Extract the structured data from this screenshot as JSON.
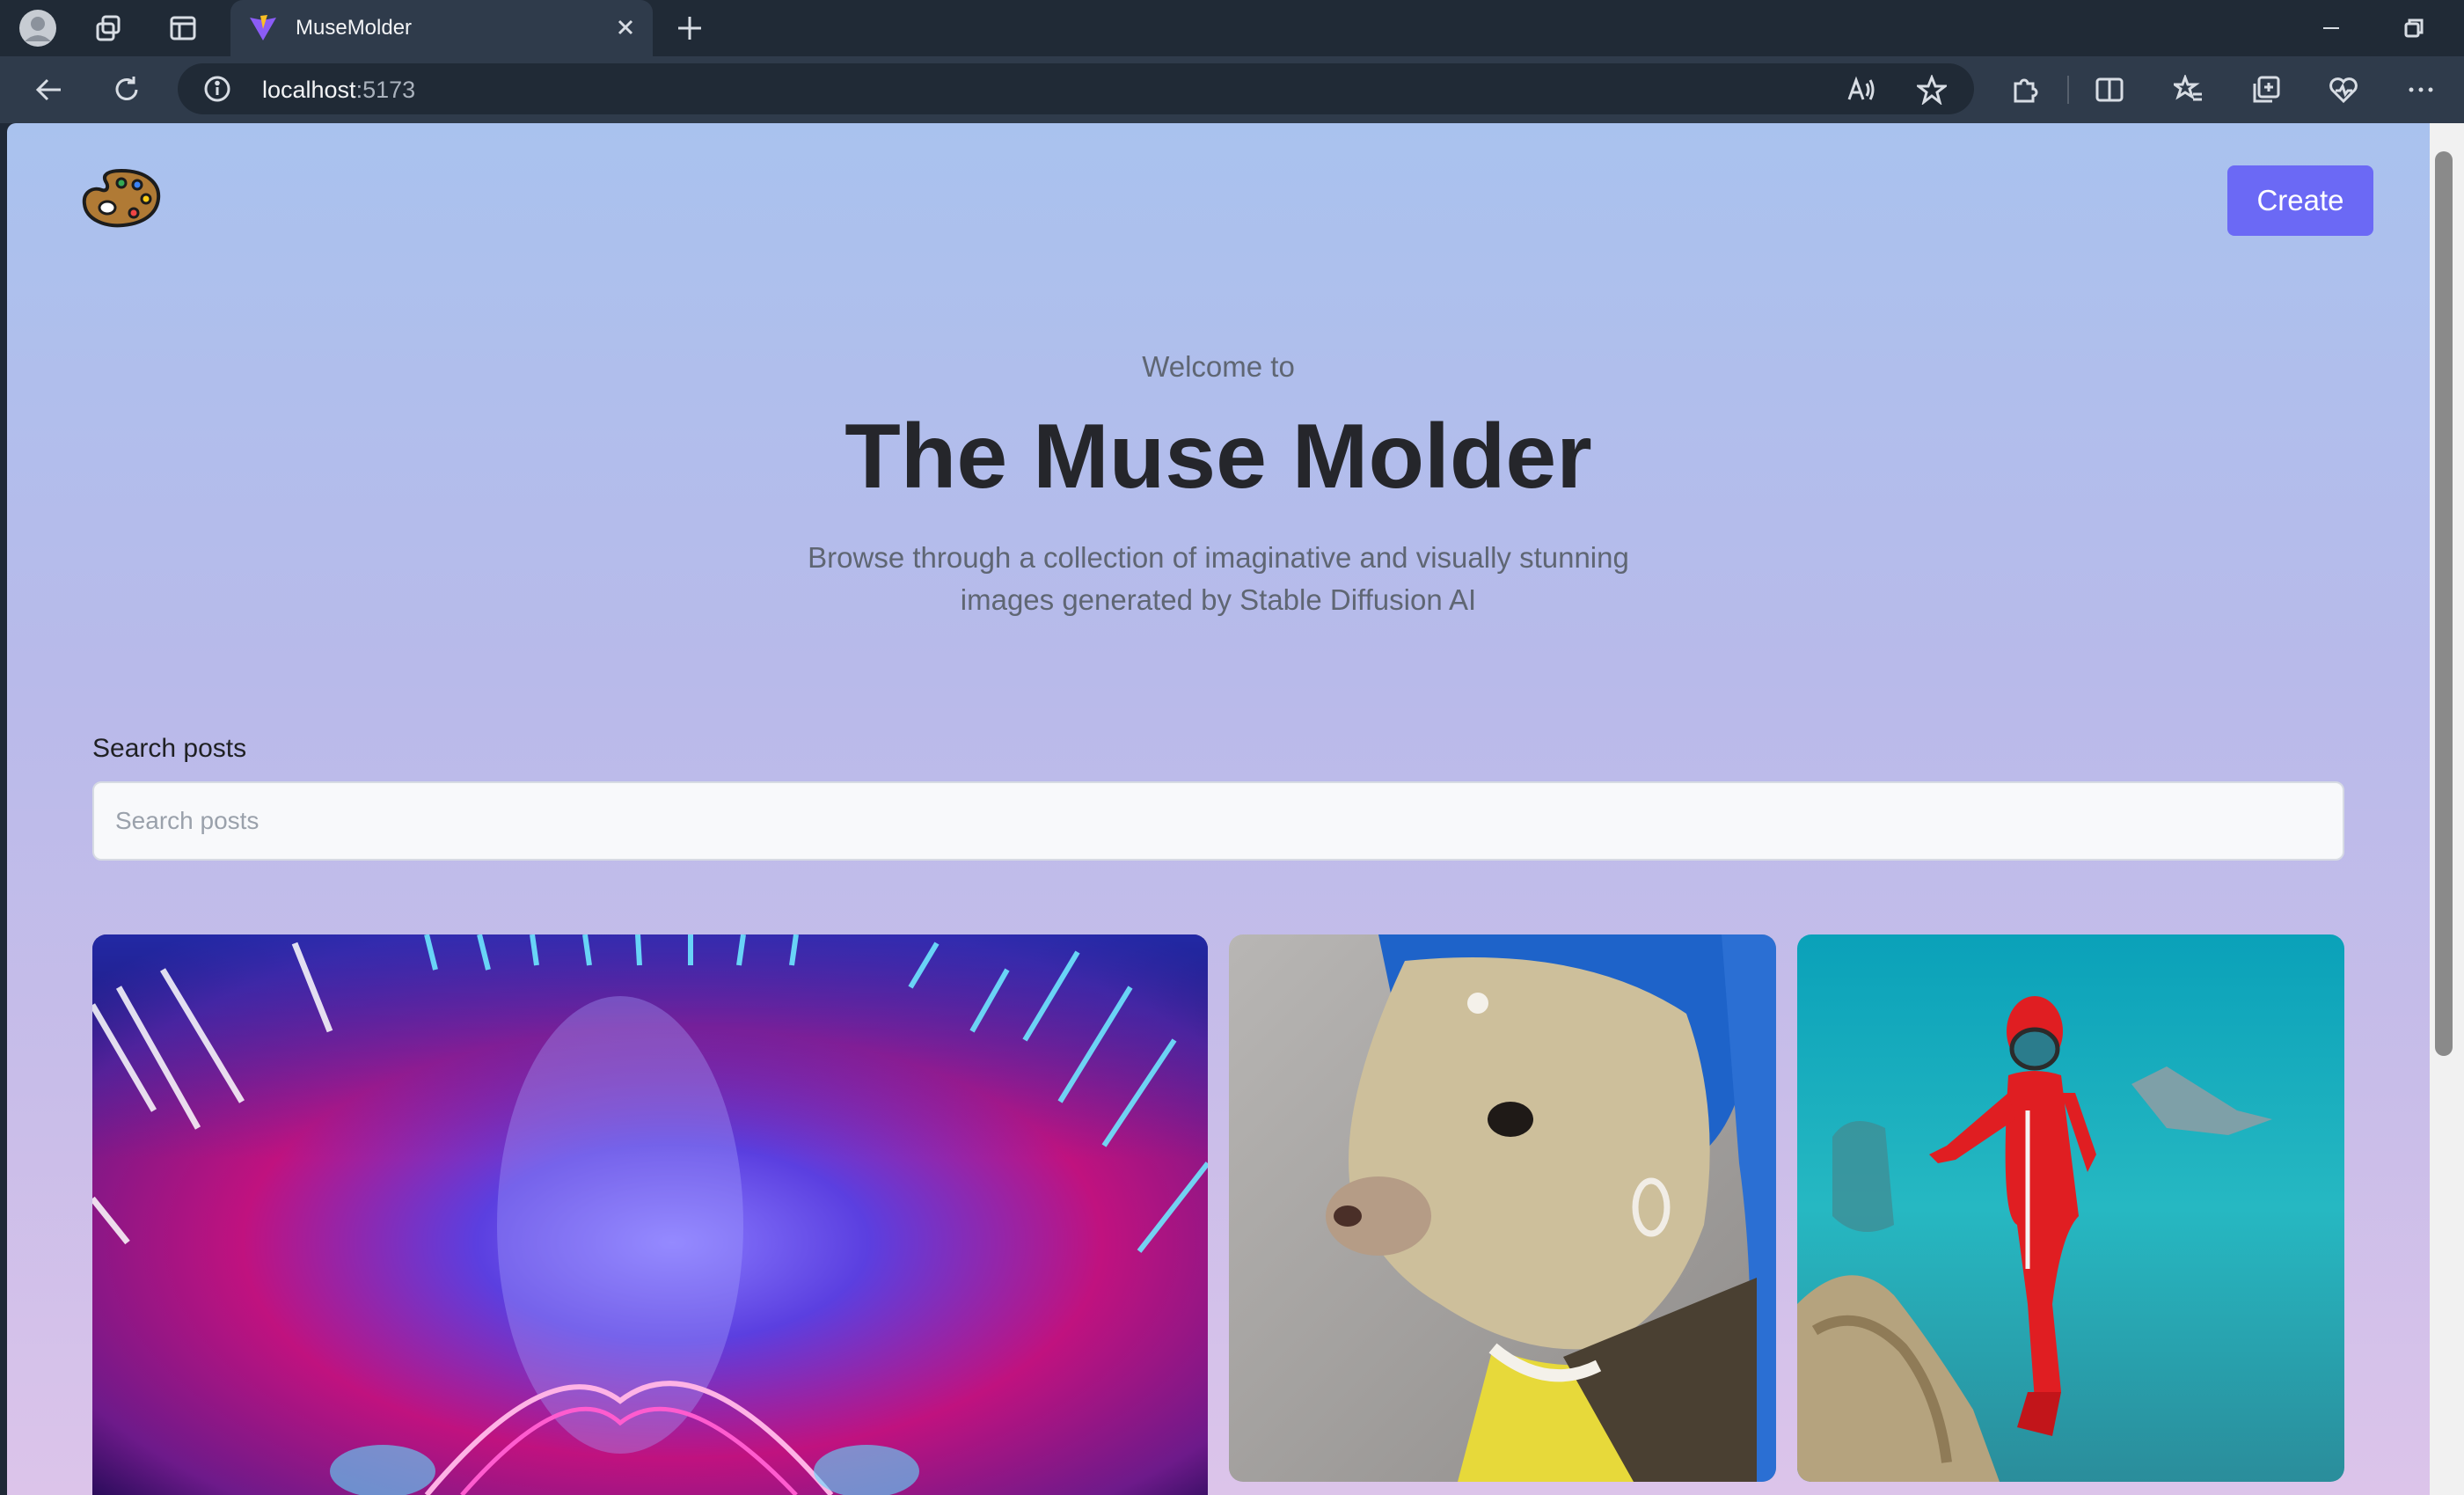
{
  "browser": {
    "tab_title": "MuseMolder",
    "url_host": "localhost",
    "url_port": ":5173"
  },
  "header": {
    "create_label": "Create"
  },
  "hero": {
    "welcome": "Welcome to",
    "title": "The Muse Molder",
    "subtitle": "Browse through a collection of imaginative and visually stunning images generated by Stable Diffusion AI"
  },
  "search": {
    "label": "Search posts",
    "placeholder": "Search posts",
    "value": ""
  },
  "colors": {
    "accent": "#6b69f5",
    "gradient_top": "#a9c2ee",
    "gradient_bottom": "#dcc4ea"
  },
  "icons": [
    "profile-icon",
    "workspaces-icon",
    "tab-actions-icon",
    "close-icon",
    "new-tab-icon",
    "back-icon",
    "refresh-icon",
    "info-icon",
    "read-aloud-icon",
    "favorite-icon",
    "extensions-icon",
    "split-screen-icon",
    "favorites-icon",
    "collections-icon",
    "browser-essentials-icon",
    "more-icon",
    "palette-logo-icon"
  ]
}
